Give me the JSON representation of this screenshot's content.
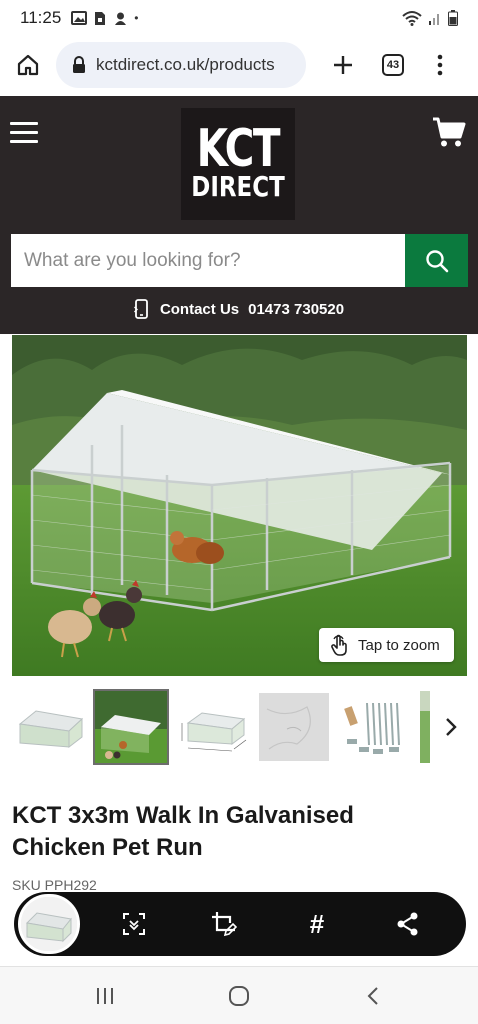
{
  "status_bar": {
    "time": "11:25",
    "dot": "•"
  },
  "browser": {
    "url": "kctdirect.co.uk/products",
    "tab_count": "43"
  },
  "site": {
    "logo_line1": "KCT",
    "logo_line2": "DIRECT",
    "search_placeholder": "What are you looking for?",
    "contact_label": "Contact Us",
    "contact_phone": "01473 730520",
    "brand_green": "#0b7a3e",
    "header_bg": "#2b2627"
  },
  "product": {
    "zoom_label": "Tap to zoom",
    "title": "KCT 3x3m Walk In Galvanised Chicken Pet Run",
    "sku": "SKU PPH292",
    "thumbnails": [
      "run-overview",
      "run-with-chickens",
      "run-dimensions",
      "cover-sheet",
      "parts-kit",
      "more"
    ]
  },
  "screenshot_toolbar": {
    "hashtag": "#"
  }
}
